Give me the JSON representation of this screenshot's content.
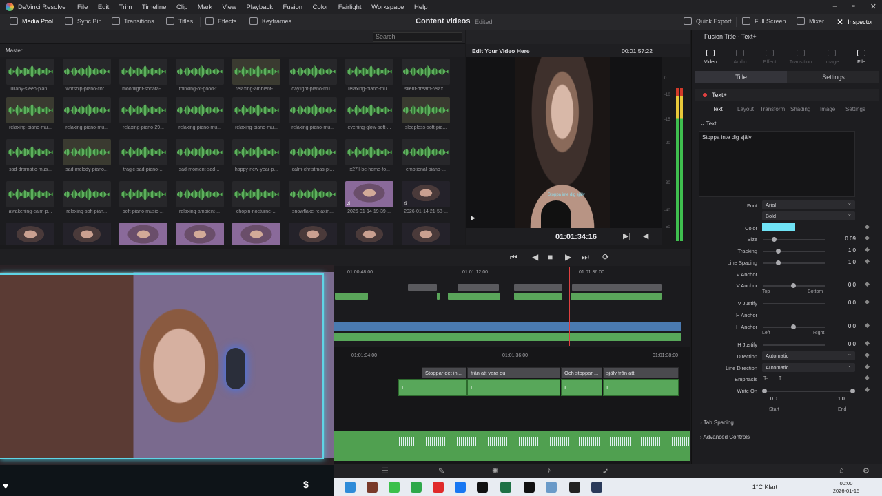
{
  "app": {
    "name": "DaVinci Resolve"
  },
  "menu": [
    "File",
    "Edit",
    "Trim",
    "Timeline",
    "Clip",
    "Mark",
    "View",
    "Playback",
    "Fusion",
    "Color",
    "Fairlight",
    "Workspace",
    "Help"
  ],
  "toolbar": {
    "media_pool": "Media Pool",
    "sync_bin": "Sync Bin",
    "transitions": "Transitions",
    "titles": "Titles",
    "effects": "Effects",
    "keyframes": "Keyframes",
    "project_title": "Content videos",
    "edited": "Edited",
    "quick_export": "Quick Export",
    "full_screen": "Full Screen",
    "mixer": "Mixer",
    "inspector": "Inspector"
  },
  "media_pool": {
    "search_placeholder": "Search",
    "bin": "Master",
    "rows": [
      [
        "lullaby-sleep-pian...",
        "worship-piano-chr...",
        "moonlight-sonata-...",
        "thinking-of-good-t...",
        "relaxing-ambient-...",
        "daylight-piano-mu...",
        "relaxing-piano-mu...",
        "silent-dream-relax..."
      ],
      [
        "relaxing-piano-mu...",
        "relaxing-piano-mu...",
        "relaxing-piano-29...",
        "relaxing-piano-mu...",
        "relaxing-piano-mu...",
        "relaxing-piano-mu...",
        "evening-glow-soft-...",
        "sleepless-soft-pia..."
      ],
      [
        "sad-dramatic-mus...",
        "sad-melody-piano...",
        "tragic-sad-piano-...",
        "sad-moment-sad-...",
        "happy-new-year-p...",
        "calm-christmas-pi...",
        "ix27ll-be-home-fo...",
        "emotional-piano-..."
      ],
      [
        "awakening-calm-p...",
        "relaxing-soft-pian...",
        "soft-piano-music-...",
        "relaxing-ambient-...",
        "chopin-nocturne-...",
        "snowflake-relaxin...",
        "2026-01-14 19-39-...",
        "2026-01-14 21-58-..."
      ]
    ]
  },
  "viewer": {
    "title": "Edit Your Video Here",
    "duration": "00:01:57:22",
    "timecode": "01:01:34:16",
    "overlay_text": "Stoppa inte dig själv",
    "meter_labels": [
      "0",
      "-5",
      "-10",
      "-15",
      "-20",
      "-30",
      "-40",
      "-50"
    ]
  },
  "inspector": {
    "title": "Fusion Title - Text+",
    "tabs": [
      "Video",
      "Audio",
      "Effect",
      "Transition",
      "Image",
      "File"
    ],
    "sub_tabs": [
      "Title",
      "Settings"
    ],
    "node": "Text+",
    "text_tabs": [
      "Text",
      "Layout",
      "Transform",
      "Shading",
      "Image",
      "Settings"
    ],
    "text_section": "Text",
    "text_value": "Stoppa inte dig själv",
    "font_label": "Font",
    "font_value": "Arial",
    "style_value": "Bold",
    "color_label": "Color",
    "size_label": "Size",
    "size_value": "0.09",
    "tracking_label": "Tracking",
    "tracking_value": "1.0",
    "line_spacing_label": "Line Spacing",
    "line_spacing_value": "1.0",
    "v_anchor_label": "V Anchor",
    "v_anchor_value": "0.0",
    "v_top": "Top",
    "v_bottom": "Bottom",
    "v_justify_label": "V Justify",
    "v_justify_value": "0.0",
    "h_anchor_label": "H Anchor",
    "h_anchor_value": "0.0",
    "h_left": "Left",
    "h_right": "Right",
    "h_justify_label": "H Justify",
    "h_justify_value": "0.0",
    "direction_label": "Direction",
    "direction_value": "Automatic",
    "line_direction_label": "Line Direction",
    "line_direction_value": "Automatic",
    "emphasis_label": "Emphasis",
    "write_on_label": "Write On",
    "write_on_start": "0.0",
    "write_on_end": "1.0",
    "start_label": "Start",
    "end_label": "End",
    "tab_spacing": "Tab Spacing",
    "advanced_controls": "Advanced Controls",
    "color_value": "#6fe2f5"
  },
  "timeline": {
    "mini_ruler": [
      "01:00:48:00",
      "01:01:12:00",
      "01:01:36:00"
    ],
    "main_ruler": [
      "01:01:34:00",
      "01:01:36:00",
      "01:01:38:00"
    ],
    "title_clips": [
      "Stoppar det in...",
      "från att vara du.",
      "Och stoppar ...",
      "själv från att"
    ]
  },
  "taskbar": {
    "weather": "1°C  Klart",
    "time": "00:00",
    "date": "2026-01-15"
  }
}
